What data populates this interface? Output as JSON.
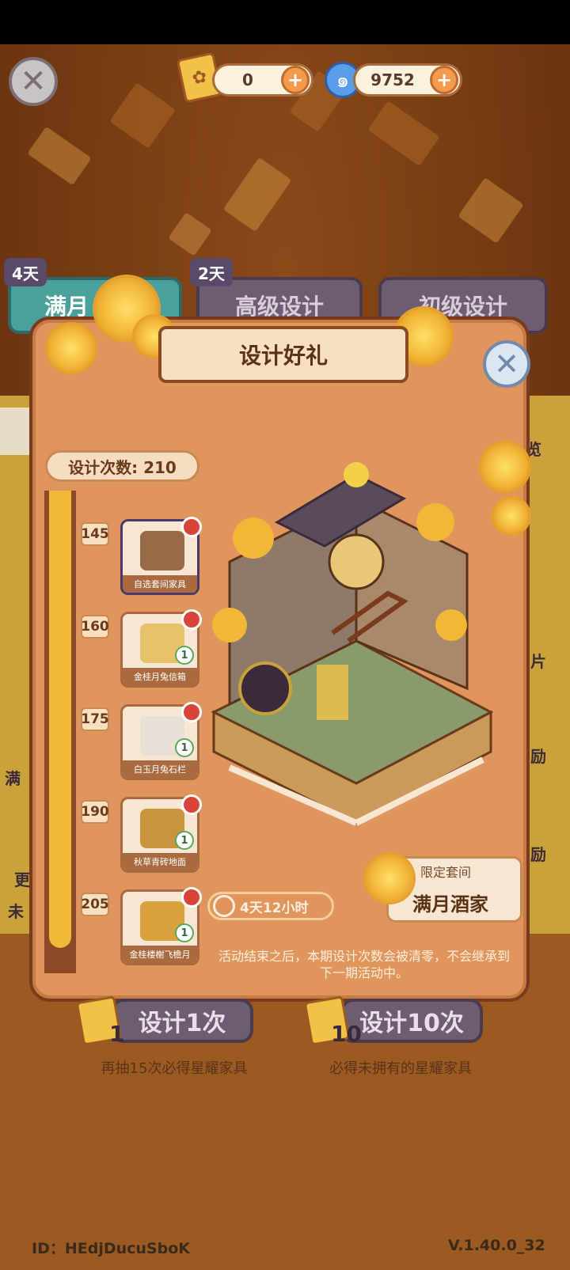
{
  "currencies": [
    {
      "icon": "design-ticket-icon",
      "value": "0"
    },
    {
      "icon": "swirl-gem-icon",
      "value": "9752"
    }
  ],
  "tabs": [
    {
      "badge": "4天",
      "label": "满月"
    },
    {
      "badge": "2天",
      "label": "高级设计"
    },
    {
      "badge": "",
      "label": "初级设计"
    }
  ],
  "modal": {
    "title": "设计好礼",
    "design_count": "设计次数: 210",
    "rewards": [
      {
        "milestone": "145",
        "label": "自选套间家具",
        "qty": ""
      },
      {
        "milestone": "160",
        "label": "金桂月兔信箱",
        "qty": "1"
      },
      {
        "milestone": "175",
        "label": "白玉月兔石栏",
        "qty": "1"
      },
      {
        "milestone": "190",
        "label": "秋草青砖地面",
        "qty": "1"
      },
      {
        "milestone": "205",
        "label": "金桂楼榭飞檐月",
        "qty": "1"
      }
    ],
    "set_label": "限定套间",
    "set_name": "满月酒家",
    "timer": "4天12小时",
    "notice": "活动结束之后，本期设计次数会被清零，不会继承到下一期活动中。"
  },
  "draw": {
    "one": {
      "label": "设计1次",
      "num": "1",
      "sub": "再抽15次必得星耀家具"
    },
    "ten": {
      "label": "设计10次",
      "num": "10",
      "sub": "必得未拥有的星耀家具"
    }
  },
  "side": {
    "right_1": "览",
    "right_2": "片",
    "right_3": "励",
    "right_4": "励",
    "left_1": "满",
    "left_2": "更",
    "left_3": "未"
  },
  "footer": {
    "id": "ID：HEdjDucuSboK",
    "version": "V.1.40.0_32"
  },
  "colors": {
    "modal_bg": "#e0955c",
    "accent_gold": "#f2b838",
    "tab_purple": "#6e5c72"
  }
}
